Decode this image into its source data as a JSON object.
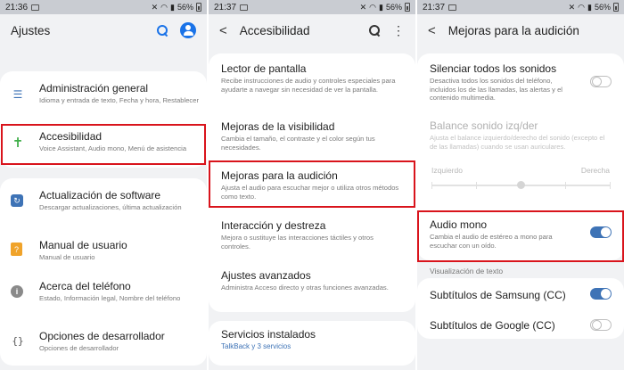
{
  "panels": [
    {
      "status": {
        "time": "21:36",
        "battery": "56%"
      },
      "appbar": {
        "title": "Ajustes",
        "search_icon": "search-icon",
        "account_icon": "account-icon"
      },
      "items": [
        {
          "label": "Administración general",
          "sub": "Idioma y entrada de texto, Fecha y hora, Restablecer",
          "icon": "sliders-icon"
        },
        {
          "label": "Accesibilidad",
          "sub": "Voice Assistant, Audio mono, Menú de asistencia",
          "icon": "accessibility-icon"
        },
        {
          "label": "Actualización de software",
          "sub": "Descargar actualizaciones, última actualización",
          "icon": "software-update-icon"
        },
        {
          "label": "Manual de usuario",
          "sub": "Manual de usuario",
          "icon": "manual-icon"
        },
        {
          "label": "Acerca del teléfono",
          "sub": "Estado, Información legal, Nombre del teléfono",
          "icon": "info-icon"
        },
        {
          "label": "Opciones de desarrollador",
          "sub": "Opciones de desarrollador",
          "icon": "developer-icon"
        }
      ]
    },
    {
      "status": {
        "time": "21:37",
        "battery": "56%"
      },
      "appbar": {
        "title": "Accesibilidad",
        "back_icon": "back-icon",
        "search_icon": "search-icon",
        "more_icon": "more-options-icon"
      },
      "items": [
        {
          "label": "Lector de pantalla",
          "sub": "Recibe instrucciones de audio y controles especiales para ayudarte a navegar sin necesidad de ver la pantalla."
        },
        {
          "label": "Mejoras de la visibilidad",
          "sub": "Cambia el tamaño, el contraste y el color según tus necesidades."
        },
        {
          "label": "Mejoras para la audición",
          "sub": "Ajusta el audio para escuchar mejor o utiliza otros métodos como texto."
        },
        {
          "label": "Interacción y destreza",
          "sub": "Mejora o sustituye las interacciones táctiles y otros controles."
        },
        {
          "label": "Ajustes avanzados",
          "sub": "Administra Acceso directo y otras funciones avanzadas."
        },
        {
          "label": "Servicios instalados",
          "sub": "TalkBack y 3 servicios"
        }
      ]
    },
    {
      "status": {
        "time": "21:37",
        "battery": "56%"
      },
      "appbar": {
        "title": "Mejoras para la audición",
        "back_icon": "back-icon"
      },
      "items": {
        "mute": {
          "label": "Silenciar todos los sonidos",
          "sub": "Desactiva todos los sonidos del teléfono, incluidos los de las llamadas, las alertas y el contenido multimedia.",
          "toggle": "off"
        },
        "balance": {
          "label": "Balance sonido izq/der",
          "sub": "Ajusta el balance izquierdo/derecho del sonido (excepto el de las llamadas) cuando se usan auriculares.",
          "left": "Izquierdo",
          "right": "Derecha",
          "value": 0.5
        },
        "mono": {
          "label": "Audio mono",
          "sub": "Cambia el audio de estéreo a mono para escuchar con un oído.",
          "toggle": "on"
        },
        "section": "Visualización de texto",
        "samsung_cc": {
          "label": "Subtítulos de Samsung (CC)",
          "toggle": "on"
        },
        "google_cc": {
          "label": "Subtítulos de Google (CC)",
          "toggle": "off"
        }
      }
    }
  ],
  "colors": {
    "highlight": "#d9141c",
    "accent": "#3e73b6",
    "background": "#f1f2f4"
  }
}
